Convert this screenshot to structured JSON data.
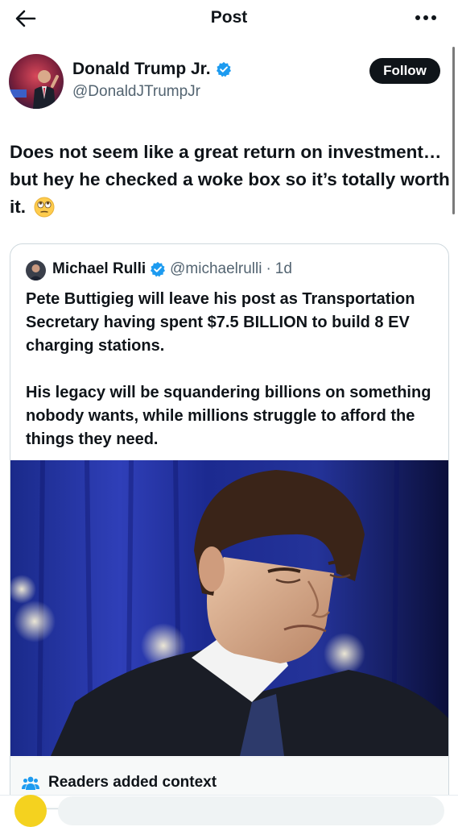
{
  "header": {
    "title": "Post",
    "back_icon": "arrow-left-icon",
    "more_icon": "more-horizontal-icon"
  },
  "author": {
    "name": "Donald Trump Jr.",
    "handle": "@DonaldJTrumpJr",
    "verified": true,
    "follow_label": "Follow"
  },
  "post": {
    "text": "Does not seem like a great return on investment… but hey he checked a woke box so it’s totally worth it.",
    "emoji": "face-with-rolling-eyes"
  },
  "quote": {
    "name": "Michael Rulli",
    "handle": "@michaelrulli",
    "dot": "·",
    "time": "1d",
    "paragraphs": [
      "Pete Buttigieg will leave his post as Transportation Secretary having spent $7.5 BILLION to build 8 EV charging stations.",
      "His legacy will be squandering billions on something nobody wants, while millions struggle to afford the things they need."
    ]
  },
  "context": {
    "label": "Readers added context"
  },
  "colors": {
    "accent": "#1d9bf0",
    "text": "#0f1419",
    "muted": "#536471",
    "follow_bg": "#0f1419"
  }
}
